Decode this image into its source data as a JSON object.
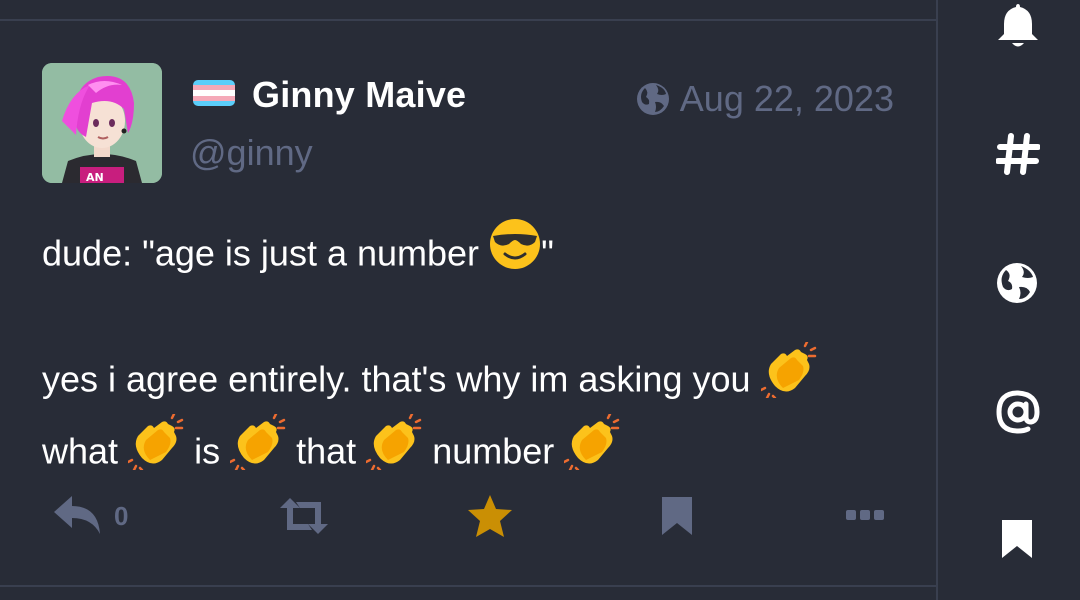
{
  "post": {
    "display_name": "Ginny Maive",
    "handle": "@ginny",
    "date": "Aug 22, 2023",
    "visibility_icon": "globe-icon",
    "line1": "dude: \"age is just a number",
    "line1_end": "\"",
    "line2": "yes i agree entirely. that's why im asking you",
    "line3_words": [
      "what",
      "is",
      "that",
      "number"
    ]
  },
  "actions": {
    "reply_count": "0",
    "boosted": false,
    "favourited": true
  },
  "colors": {
    "background": "#282c37",
    "muted": "#606984",
    "favourite": "#ca8f04",
    "divider": "#393f4f"
  },
  "sidebar": {
    "items": [
      "bell-icon",
      "hashtag-icon",
      "globe-icon",
      "at-icon",
      "bookmark-icon"
    ]
  }
}
